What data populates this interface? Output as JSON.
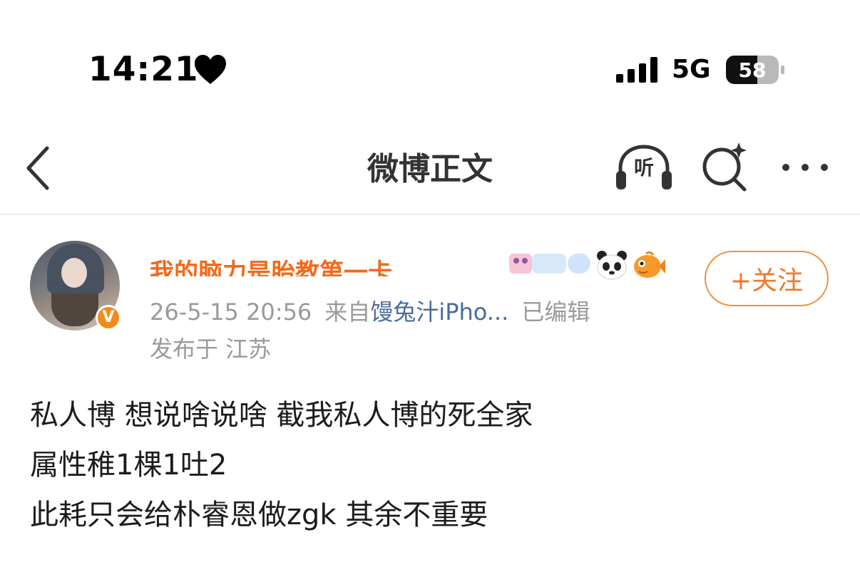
{
  "status_bar": {
    "time": "14:21",
    "network": "5G",
    "battery_level": "58",
    "icons": [
      "heart-icon",
      "signal-icon",
      "battery-icon"
    ]
  },
  "nav": {
    "title": "微博正文",
    "listen_label": "听",
    "icons": [
      "back-icon",
      "headphones-icon",
      "ai-search-icon",
      "more-icon"
    ]
  },
  "post": {
    "author_name": "我的脑力是胎教第一卡",
    "verified_badge": "V",
    "date": "26-5-15 20:56",
    "source_prefix": "来自",
    "source": "馒兔汁iPho...",
    "edited": "已编辑",
    "location": "发布于 江苏",
    "follow_label": "+关注",
    "lines": [
      "私人博 想说啥说啥 截我私人博的死全家",
      "属性稚1棵1吐2",
      "此耗只会给朴睿恩做zgk 其余不重要"
    ]
  },
  "colors": {
    "accent": "#f26a1b",
    "source_link": "#4a6a9c",
    "meta": "#9a9a9a",
    "follow_border": "#f08e3c"
  }
}
